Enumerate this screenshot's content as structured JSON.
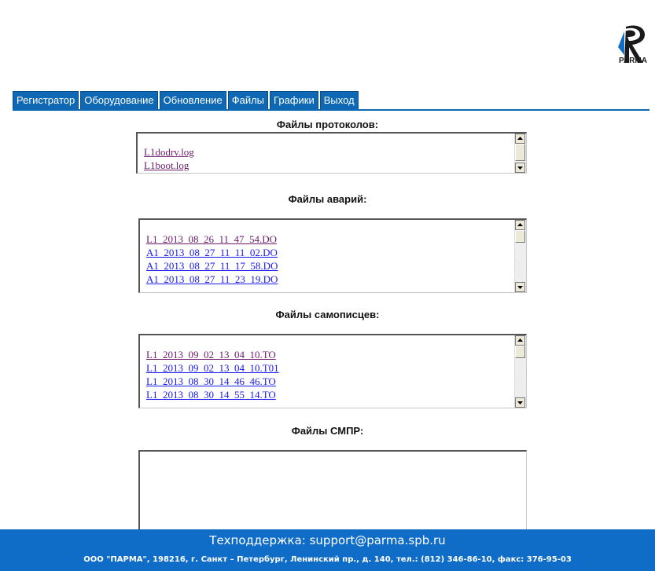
{
  "logo": {
    "text": "PARMA"
  },
  "tabs": [
    "Регистратор",
    "Оборудование",
    "Обновление",
    "Файлы",
    "Графики",
    "Выход"
  ],
  "sections": {
    "protocols": {
      "title": "Файлы протоколов:",
      "files": [
        "L1dodrv.log",
        "L1boot.log"
      ]
    },
    "accidents": {
      "title": "Файлы аварий:",
      "files": [
        "L1_2013_08_26_11_47_54.DO",
        "A1_2013_08_27_11_11_02.DO",
        "A1_2013_08_27_11_17_58.DO",
        "A1_2013_08_27_11_23_19.DO"
      ]
    },
    "recorders": {
      "title": "Файлы самописцев:",
      "files": [
        "L1_2013_09_02_13_04_10.TO",
        "L1_2013_09_02_13_04_10.T01",
        "L1_2013_08_30_14_46_46.TO",
        "L1_2013_08_30_14_55_14.TO"
      ]
    },
    "smpr": {
      "title": "Файлы СМПР:"
    }
  },
  "footer": {
    "support": "Техподдержка: support@parma.spb.ru",
    "address": "ООО \"ПАРМА\", 198216, г. Санкт – Петербург, Ленинский пр., д. 140, тел.: (812) 346-86-10, факс: 376-95-03"
  },
  "colors": {
    "tab_bg": "#0e68b3",
    "footer_bg": "#0f6dc8",
    "visited_link": "#6b1c6b",
    "link": "#1a1aee"
  }
}
